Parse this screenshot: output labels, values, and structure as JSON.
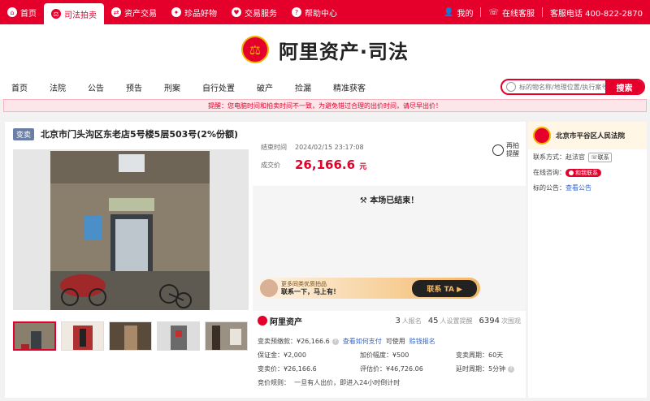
{
  "topbar": {
    "nav": [
      {
        "label": "首页",
        "icon": "home-icon",
        "glyph": "⌂"
      },
      {
        "label": "司法拍卖",
        "icon": "gavel-icon",
        "glyph": "⚖",
        "active": true
      },
      {
        "label": "资产交易",
        "icon": "exchange-icon",
        "glyph": "⇄"
      },
      {
        "label": "珍品好物",
        "icon": "gem-icon",
        "glyph": "✦"
      },
      {
        "label": "交易服务",
        "icon": "heart-icon",
        "glyph": "♥"
      },
      {
        "label": "帮助中心",
        "icon": "help-icon",
        "glyph": "?"
      }
    ],
    "my_account": "我的",
    "online_service": "在线客服",
    "hotline": "客服电话 400-822-2870"
  },
  "brand": {
    "name": "阿里资产·司法"
  },
  "categories": [
    "首页",
    "法院",
    "公告",
    "预告",
    "刑案",
    "自行处置",
    "破产",
    "捡漏",
    "精准获客"
  ],
  "search": {
    "placeholder": "标的物名称/地理位置/执行案号",
    "button": "搜索"
  },
  "notice": "提醒：您电脑时间和拍卖时间不一致，为避免错过合理的出价时间，请尽早出价！",
  "item": {
    "badge": "变卖",
    "title": "北京市门头沟区东老店5号楼5层503号(2%份额)",
    "end_label": "结束时间",
    "end_time": "2024/02/15 23:17:08",
    "deal_label": "成交价",
    "deal_price": "26,166.6",
    "currency": "元",
    "remind": "再拍\n提醒",
    "ended": "本场已结束！",
    "banner": {
      "line1": "更多同类优质拍品",
      "line2": "联系一下，马上有！",
      "button": "联系 TA ▶"
    }
  },
  "stats": {
    "logo": "阿里资产",
    "signups": "3",
    "signups_label": "人报名",
    "reminders": "45",
    "reminders_label": "人设置提醒",
    "views": "6394",
    "views_label": "次围观"
  },
  "details": [
    [
      {
        "t": "变卖预缴款：¥26,166.6"
      },
      {
        "t": "查看如何支付",
        "link": true
      },
      {
        "t": "可使用"
      },
      {
        "t": "赊钱报名",
        "link": true
      }
    ],
    [
      {
        "t": "保证金：¥2,000"
      },
      {
        "t": "加价幅度：¥500"
      },
      {
        "t": "变卖周期：60天"
      }
    ],
    [
      {
        "t": "变卖价：¥26,166.6"
      },
      {
        "t": "评估价：¥46,726.06"
      },
      {
        "t": "延时周期：5分钟",
        "q": true
      }
    ],
    [
      {
        "t": "竞价规则：  一旦有人出价，即进入24小时倒计时"
      }
    ]
  ],
  "court": {
    "name": "北京市平谷区人民法院",
    "contact_label": "联系方式：",
    "contact_name": "赵法官",
    "contact_btn": "联系",
    "chat_label": "在线咨询：",
    "chat_btn": "和我联系",
    "notice_label": "标的公告：",
    "notice_link": "查看公告"
  }
}
